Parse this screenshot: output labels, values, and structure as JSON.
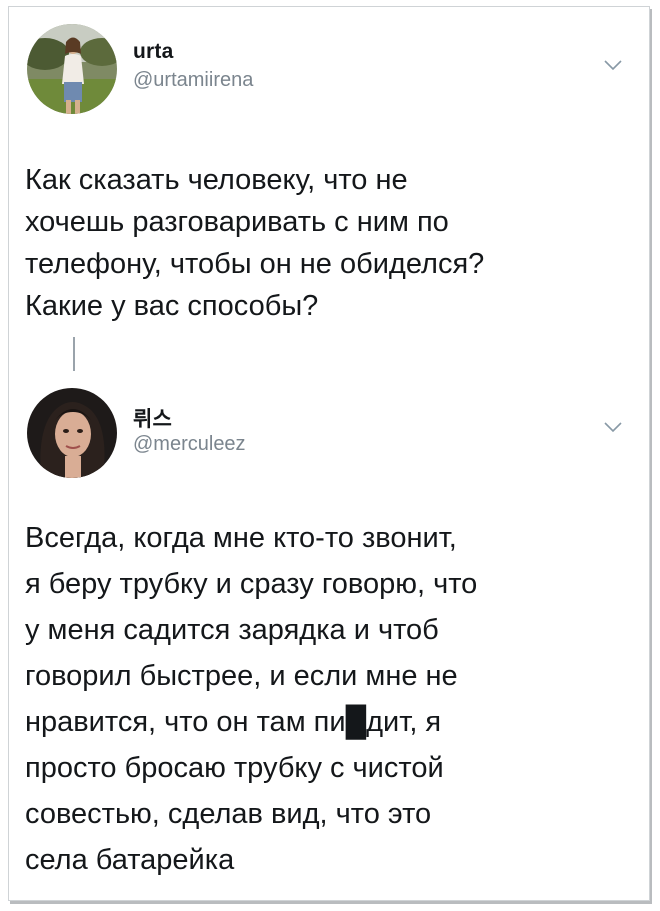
{
  "tweets": [
    {
      "name": "urta",
      "handle": "@urtamiirena",
      "text": "Как сказать человеку, что не\nхочешь разговаривать с ним по\nтелефону, чтобы он не обиделся?\nКакие у вас способы?"
    },
    {
      "name": "뤼스",
      "handle": "@merculeez",
      "text": "Всегда, когда мне кто-то звонит,\nя беру трубку и сразу говорю, что\nу меня садится зарядка и чтоб\nговорил быстрее, и если мне не\nнравится, что он там пи█дит, я\nпросто бросаю трубку с чистой\nсовестью, сделав вид, что это\nсела батарейка"
    }
  ],
  "icons": {
    "menu": "chevron-down-icon",
    "avatar": "avatar"
  },
  "colors": {
    "text": "#14171a",
    "handle": "#7b858e",
    "thread_line": "#9aa3ab",
    "chevron": "#8899a6"
  }
}
